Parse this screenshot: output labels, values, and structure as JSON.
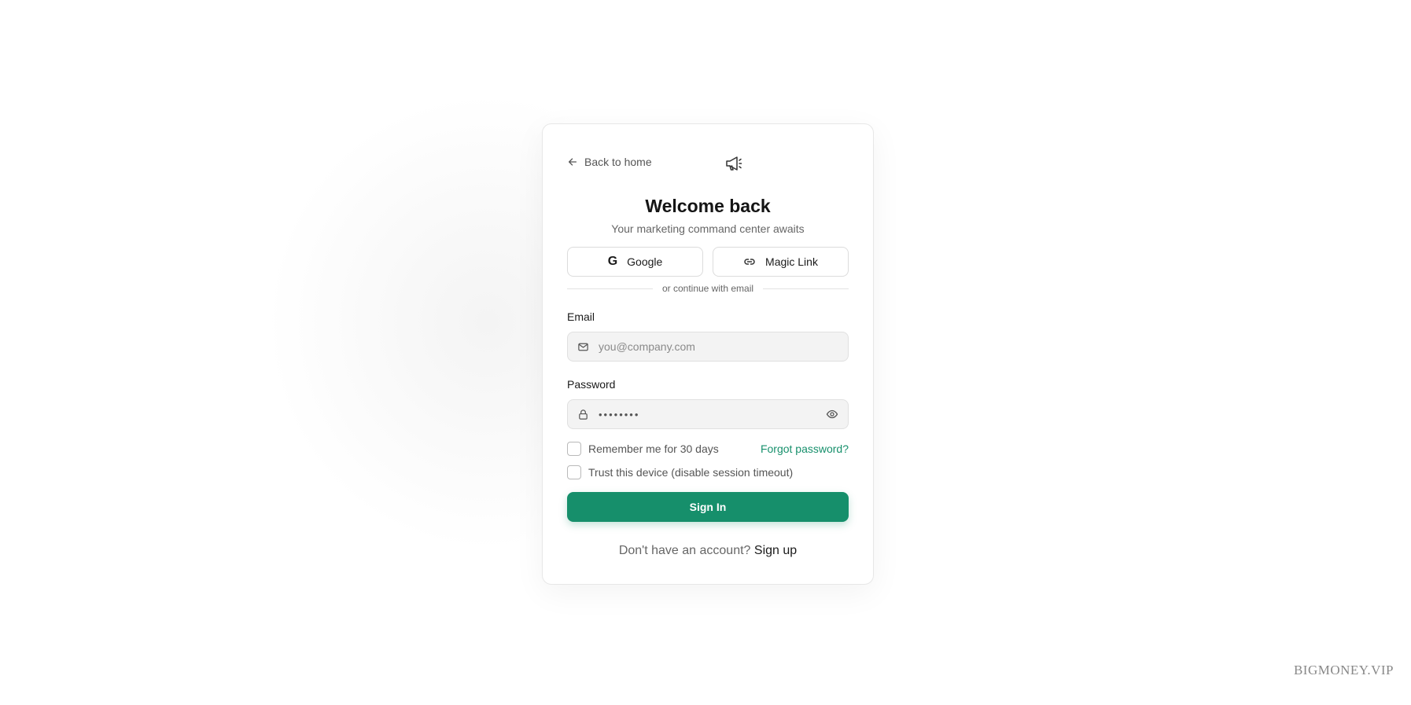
{
  "header": {
    "back_label": "Back to home",
    "logo_icon": "megaphone-icon"
  },
  "hero": {
    "title": "Welcome back",
    "subtitle": "Your marketing command center awaits"
  },
  "oauth": {
    "google_label": "Google",
    "google_icon": "G",
    "magic_link_label": "Magic Link",
    "magic_link_icon": "link-icon"
  },
  "divider_text": "or continue with email",
  "form": {
    "email_label": "Email",
    "email_placeholder": "you@company.com",
    "email_value": "",
    "password_label": "Password",
    "password_value": "••••••••",
    "remember_label": "Remember me for 30 days",
    "remember_checked": false,
    "forgot_label": "Forgot password?",
    "trust_label": "Trust this device (disable session timeout)",
    "trust_checked": false,
    "submit_label": "Sign In"
  },
  "footer": {
    "prompt": "Don't have an account?",
    "signup_label": "Sign up"
  },
  "watermark": "BIGMONEY.VIP",
  "colors": {
    "accent": "#168f6b",
    "link": "#17906c"
  }
}
